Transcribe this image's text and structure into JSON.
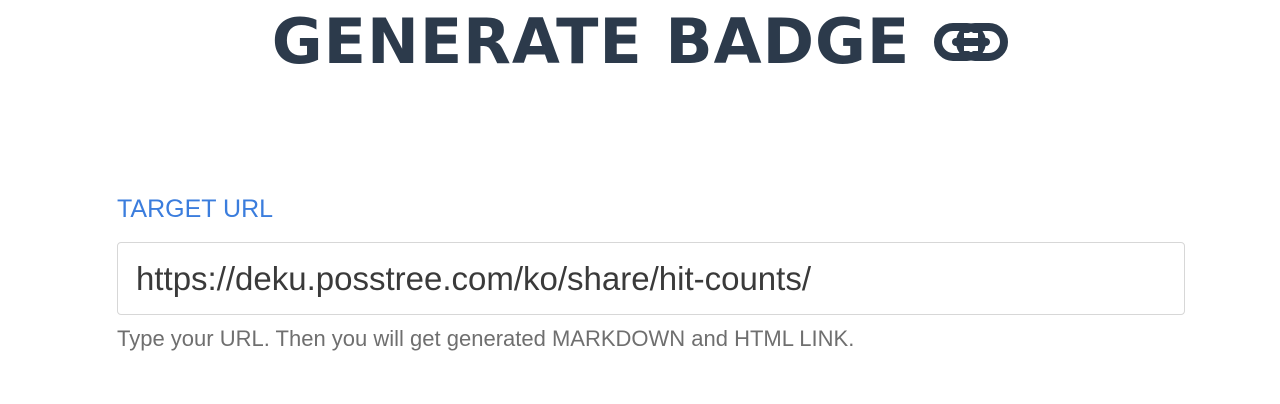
{
  "header": {
    "title": "GENERATE BADGE",
    "icon": "link-icon",
    "title_color": "#2c3a4b"
  },
  "form": {
    "label": "TARGET URL",
    "label_color": "#3b7ddd",
    "url_value": "https://deku.posstree.com/ko/share/hit-counts/",
    "help_text": "Type your URL. Then you will get generated MARKDOWN and HTML LINK."
  }
}
